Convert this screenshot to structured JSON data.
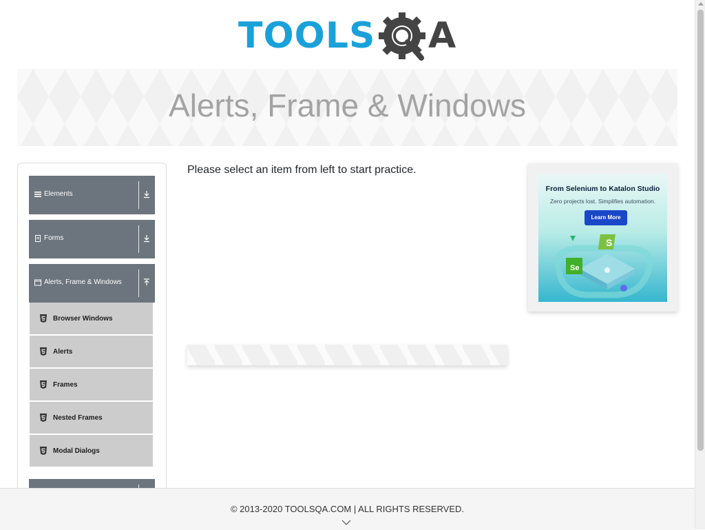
{
  "header": {
    "logo": {
      "brand_left": "TOOLS",
      "brand_right": "A"
    }
  },
  "banner": {
    "title": "Alerts, Frame & Windows"
  },
  "sidebar": {
    "groups": [
      {
        "label": "Elements",
        "icon": "list-icon",
        "expanded": false
      },
      {
        "label": "Forms",
        "icon": "document-icon",
        "expanded": false
      },
      {
        "label": "Alerts, Frame & Windows",
        "icon": "window-icon",
        "expanded": true
      }
    ],
    "items": [
      {
        "label": "Browser Windows",
        "icon": "html5-icon"
      },
      {
        "label": "Alerts",
        "icon": "html5-icon"
      },
      {
        "label": "Frames",
        "icon": "html5-icon"
      },
      {
        "label": "Nested Frames",
        "icon": "html5-icon"
      },
      {
        "label": "Modal Dialogs",
        "icon": "html5-icon"
      }
    ]
  },
  "main": {
    "intro": "Please select an item from left to start practice."
  },
  "ad": {
    "title": "From Selenium to Katalon Studio",
    "subtitle": "Zero projects lost. Simplifies automation.",
    "button": "Learn More",
    "colors": {
      "button": "#1a47c8",
      "heading": "#0e1f3b"
    }
  },
  "footer": {
    "copyright": "© 2013-2020 TOOLSQA.COM | ALL RIGHTS RESERVED."
  },
  "colors": {
    "accent": "#1aa1d9",
    "group_bg": "#6c757d",
    "item_bg": "#cccccc"
  }
}
